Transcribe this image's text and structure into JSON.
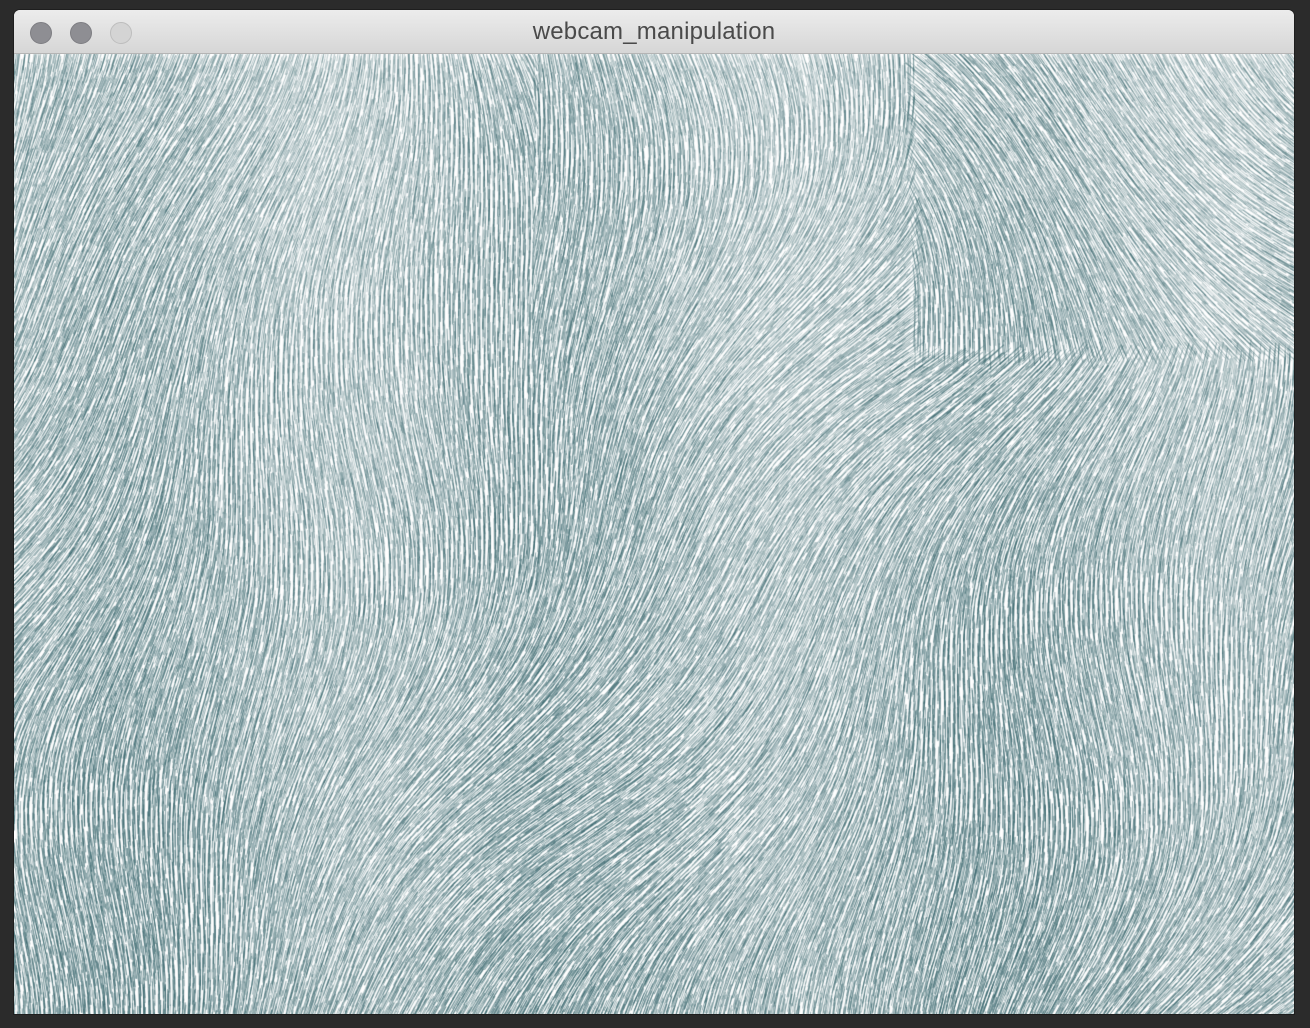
{
  "window": {
    "title": "webcam_manipulation"
  },
  "controls": {
    "close": "close",
    "minimize": "minimize",
    "zoom": "zoom"
  },
  "canvas": {
    "background": "#ffffff",
    "stroke_color": "#2f5f66",
    "description_icon": "flow-field-lines"
  }
}
